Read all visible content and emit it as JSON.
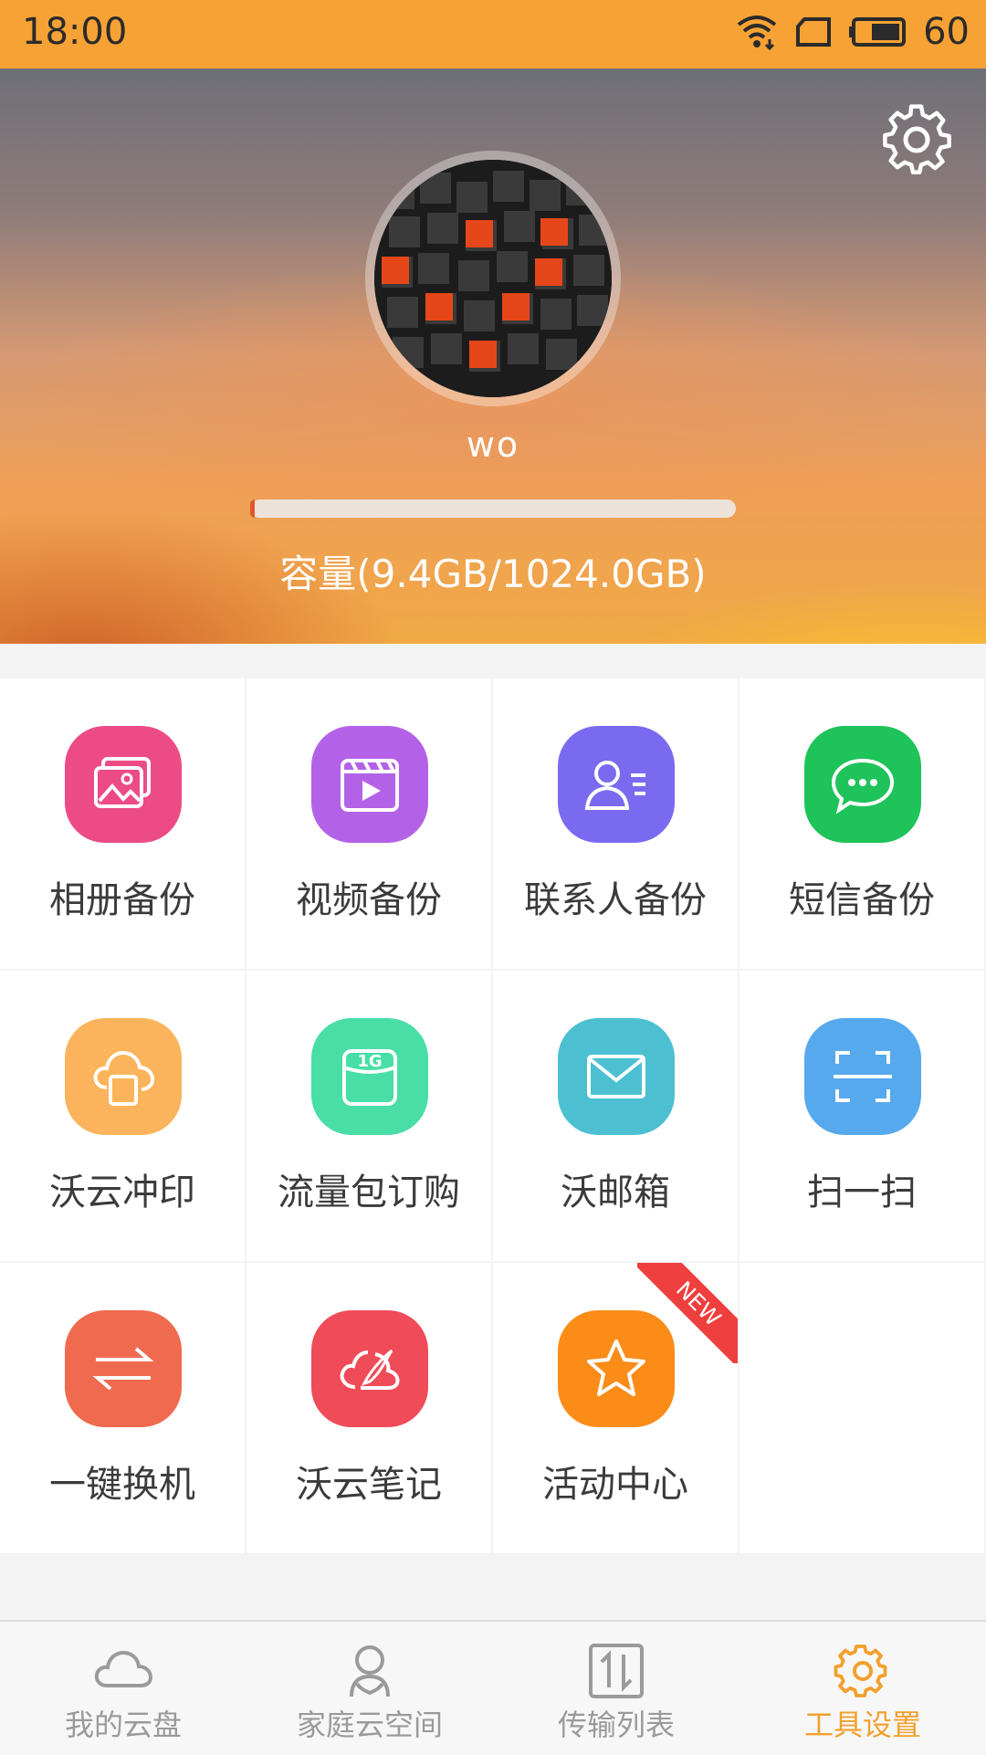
{
  "status_bar": {
    "time": "18:00",
    "battery": "60",
    "icons": [
      "wifi-icon",
      "sim-icon",
      "battery-icon"
    ]
  },
  "header": {
    "username": "wo",
    "capacity_text": "容量(9.4GB/1024.0GB)",
    "capacity_used_fraction": 0.0092,
    "settings_icon": "gear-icon"
  },
  "tiles": [
    {
      "label": "相册备份",
      "icon": "photo-album-icon",
      "color": "#ec4b86"
    },
    {
      "label": "视频备份",
      "icon": "video-clapper-icon",
      "color": "#b362e8"
    },
    {
      "label": "联系人备份",
      "icon": "contact-card-icon",
      "color": "#7a6af0"
    },
    {
      "label": "短信备份",
      "icon": "chat-bubble-icon",
      "color": "#1ec35a"
    },
    {
      "label": "沃云冲印",
      "icon": "cloud-print-icon",
      "color": "#fbb45b"
    },
    {
      "label": "流量包订购",
      "icon": "data-package-icon",
      "color": "#48dea6"
    },
    {
      "label": "沃邮箱",
      "icon": "mail-icon",
      "color": "#4cc0d1"
    },
    {
      "label": "扫一扫",
      "icon": "scan-icon",
      "color": "#56a9ec"
    },
    {
      "label": "一键换机",
      "icon": "transfer-arrows-icon",
      "color": "#f06a50"
    },
    {
      "label": "沃云笔记",
      "icon": "cloud-note-icon",
      "color": "#f04b58"
    },
    {
      "label": "活动中心",
      "icon": "star-icon",
      "color": "#fb8c18",
      "badge": "NEW"
    }
  ],
  "data_package_badge": "1G",
  "bottom_nav": [
    {
      "label": "我的云盘",
      "icon": "cloud-icon",
      "active": false
    },
    {
      "label": "家庭云空间",
      "icon": "family-icon",
      "active": false
    },
    {
      "label": "传输列表",
      "icon": "transfer-list-icon",
      "active": false
    },
    {
      "label": "工具设置",
      "icon": "gear-icon",
      "active": true
    }
  ],
  "colors": {
    "status_bar": "#f7a234",
    "accent": "#f2a02d",
    "capacity_fill": "#e0572c"
  }
}
